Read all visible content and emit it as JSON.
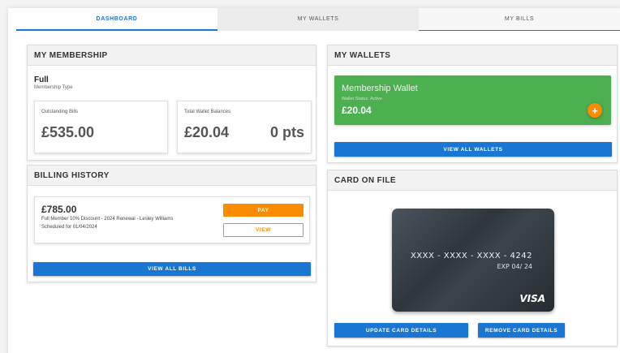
{
  "tabs": [
    {
      "label": "DASHBOARD"
    },
    {
      "label": "MY WALLETS"
    },
    {
      "label": "MY BILLS"
    }
  ],
  "membership": {
    "title": "MY MEMBERSHIP",
    "type_value": "Full",
    "type_label": "Membership Type",
    "outstanding_label": "Outstanding Bills",
    "outstanding_value": "£535.00",
    "wallet_label": "Total Wallet Balances",
    "wallet_value": "£20.04",
    "points_value": "0 pts"
  },
  "billing": {
    "title": "BILLING HISTORY",
    "bill": {
      "amount": "£785.00",
      "description": "Full Member 10% Discount - 2024 Renewal - Lesley Williams",
      "scheduled": "Scheduled for 01/04/2024",
      "pay_label": "PAY",
      "view_label": "VIEW"
    },
    "view_all_label": "VIEW ALL BILLS"
  },
  "wallets": {
    "title": "MY WALLETS",
    "card": {
      "name": "Membership Wallet",
      "status": "Wallet Status: Active",
      "balance": "£20.04",
      "add_icon": "plus-icon"
    },
    "view_all_label": "VIEW ALL WALLETS"
  },
  "card_on_file": {
    "title": "CARD ON FILE",
    "number": "XXXX - XXXX - XXXX - 4242",
    "expiry": "EXP 04/ 24",
    "brand": "VISA",
    "update_label": "UPDATE CARD DETAILS",
    "remove_label": "REMOVE CARD DETAILS"
  },
  "colors": {
    "primary": "#1976d2",
    "accent": "#fb8c00",
    "wallet_green": "#4caf50"
  }
}
